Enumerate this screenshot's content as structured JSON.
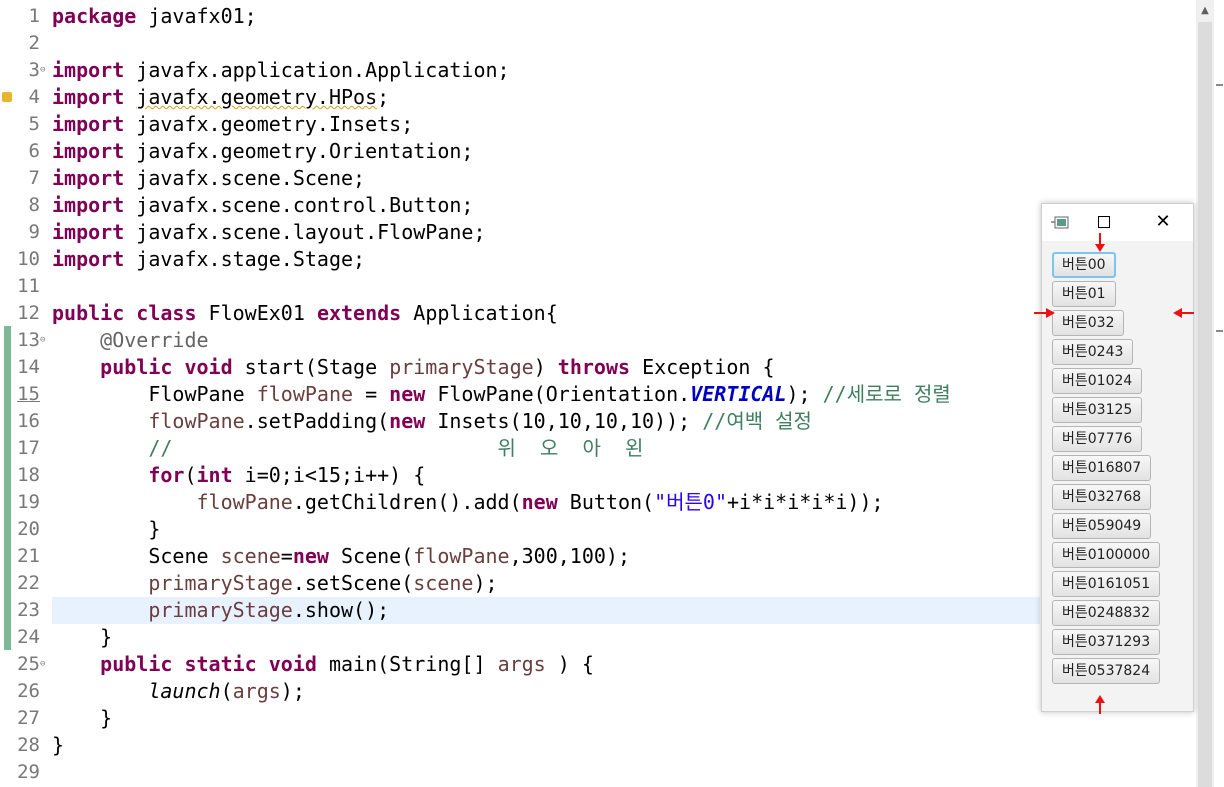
{
  "editor": {
    "lines": [
      {
        "n": "1",
        "fold": "",
        "t": [
          [
            "kw",
            "package"
          ],
          [
            "",
            "  javafx01;"
          ]
        ]
      },
      {
        "n": "2",
        "fold": "",
        "t": []
      },
      {
        "n": "3",
        "fold": "⊖",
        "t": [
          [
            "kw",
            "import"
          ],
          [
            "",
            "  javafx.application.Application;"
          ]
        ]
      },
      {
        "n": "4",
        "fold": "",
        "t": [
          [
            "kw",
            "import"
          ],
          [
            "",
            " "
          ],
          [
            "wavy",
            "javafx.geometry.HPos"
          ],
          [
            "",
            ";"
          ]
        ]
      },
      {
        "n": "5",
        "fold": "",
        "t": [
          [
            "kw",
            "import"
          ],
          [
            "",
            "  javafx.geometry.Insets;"
          ]
        ]
      },
      {
        "n": "6",
        "fold": "",
        "t": [
          [
            "kw",
            "import"
          ],
          [
            "",
            "  javafx.geometry.Orientation;"
          ]
        ]
      },
      {
        "n": "7",
        "fold": "",
        "t": [
          [
            "kw",
            "import"
          ],
          [
            "",
            "  javafx.scene.Scene;"
          ]
        ]
      },
      {
        "n": "8",
        "fold": "",
        "t": [
          [
            "kw",
            "import"
          ],
          [
            "",
            "  javafx.scene.control.Button;"
          ]
        ]
      },
      {
        "n": "9",
        "fold": "",
        "t": [
          [
            "kw",
            "import"
          ],
          [
            "",
            "  javafx.scene.layout.FlowPane;"
          ]
        ]
      },
      {
        "n": "10",
        "fold": "",
        "t": [
          [
            "kw",
            "import"
          ],
          [
            "",
            "  javafx.stage.Stage;"
          ]
        ]
      },
      {
        "n": "11",
        "fold": "",
        "t": []
      },
      {
        "n": "12",
        "fold": "",
        "t": [
          [
            "kw",
            "public"
          ],
          [
            "",
            " "
          ],
          [
            "kw",
            "class"
          ],
          [
            "",
            " FlowEx01 "
          ],
          [
            "kw",
            "extends"
          ],
          [
            "",
            " Application{"
          ]
        ]
      },
      {
        "n": "13",
        "fold": "⊖",
        "t": [
          [
            "",
            "    "
          ],
          [
            "ann",
            "@Override"
          ]
        ]
      },
      {
        "n": "14",
        "fold": "",
        "t": [
          [
            "",
            "    "
          ],
          [
            "kw",
            "public"
          ],
          [
            "",
            " "
          ],
          [
            "kw",
            "void"
          ],
          [
            "",
            " start(Stage "
          ],
          [
            "fld",
            "primaryStage"
          ],
          [
            "",
            ") "
          ],
          [
            "kw",
            "throws"
          ],
          [
            "",
            " Exception {"
          ]
        ]
      },
      {
        "n": "15",
        "fold": "",
        "t": [
          [
            "",
            "        FlowPane "
          ],
          [
            "fld",
            "flowPane"
          ],
          [
            "",
            " = "
          ],
          [
            "kw",
            "new"
          ],
          [
            "",
            " FlowPane(Orientation."
          ],
          [
            "const",
            "VERTICAL"
          ],
          [
            "",
            "); "
          ],
          [
            "cmt",
            "//세로로 정렬"
          ]
        ]
      },
      {
        "n": "16",
        "fold": "",
        "t": [
          [
            "",
            "        "
          ],
          [
            "fld",
            "flowPane"
          ],
          [
            "",
            ".setPadding("
          ],
          [
            "kw",
            "new"
          ],
          [
            "",
            " Insets(10,10,10,10)); "
          ],
          [
            "cmt",
            "//여백 설정"
          ]
        ]
      },
      {
        "n": "17",
        "fold": "",
        "t": [
          [
            "",
            "        "
          ],
          [
            "cmt",
            "//                           위  오  아  왼"
          ]
        ]
      },
      {
        "n": "18",
        "fold": "",
        "t": [
          [
            "",
            "        "
          ],
          [
            "kw",
            "for"
          ],
          [
            "",
            "("
          ],
          [
            "kw",
            "int"
          ],
          [
            "",
            " i=0;i<15;i++) {"
          ]
        ]
      },
      {
        "n": "19",
        "fold": "",
        "t": [
          [
            "",
            "            "
          ],
          [
            "fld",
            "flowPane"
          ],
          [
            "",
            ".getChildren().add("
          ],
          [
            "kw",
            "new"
          ],
          [
            "",
            " Button("
          ],
          [
            "str",
            "\"버튼0\""
          ],
          [
            "",
            "+i*i*i*i*i));"
          ]
        ]
      },
      {
        "n": "20",
        "fold": "",
        "t": [
          [
            "",
            "        }"
          ]
        ]
      },
      {
        "n": "21",
        "fold": "",
        "t": [
          [
            "",
            "        Scene "
          ],
          [
            "fld",
            "scene"
          ],
          [
            "",
            "="
          ],
          [
            "kw",
            "new"
          ],
          [
            "",
            " Scene("
          ],
          [
            "fld",
            "flowPane"
          ],
          [
            "",
            ",300,100);"
          ]
        ]
      },
      {
        "n": "22",
        "fold": "",
        "t": [
          [
            "",
            "        "
          ],
          [
            "fld",
            "primaryStage"
          ],
          [
            "",
            ".setScene("
          ],
          [
            "fld",
            "scene"
          ],
          [
            "",
            ");"
          ]
        ]
      },
      {
        "n": "23",
        "fold": "",
        "t": [
          [
            "",
            "        "
          ],
          [
            "fld",
            "primaryStage"
          ],
          [
            "",
            ".show();"
          ]
        ]
      },
      {
        "n": "24",
        "fold": "",
        "t": [
          [
            "",
            "    }"
          ]
        ]
      },
      {
        "n": "25",
        "fold": "⊖",
        "t": [
          [
            "",
            "    "
          ],
          [
            "kw",
            "public"
          ],
          [
            "",
            " "
          ],
          [
            "kw",
            "static"
          ],
          [
            "",
            " "
          ],
          [
            "kw",
            "void"
          ],
          [
            "",
            " main(String[] "
          ],
          [
            "fld",
            "args"
          ],
          [
            "",
            " ) {"
          ]
        ]
      },
      {
        "n": "26",
        "fold": "",
        "t": [
          [
            "",
            "        "
          ],
          [
            "ital",
            "launch"
          ],
          [
            "",
            "("
          ],
          [
            "fld",
            "args"
          ],
          [
            "",
            ");"
          ]
        ]
      },
      {
        "n": "27",
        "fold": "",
        "t": [
          [
            "",
            "    }"
          ]
        ]
      },
      {
        "n": "28",
        "fold": "",
        "t": [
          [
            "",
            "}"
          ]
        ]
      },
      {
        "n": "29",
        "fold": "",
        "t": []
      }
    ]
  },
  "fx_window": {
    "buttons": [
      "버튼00",
      "버튼01",
      "버튼032",
      "버튼0243",
      "버튼01024",
      "버튼03125",
      "버튼07776",
      "버튼016807",
      "버튼032768",
      "버튼059049",
      "버튼0100000",
      "버튼0161051",
      "버튼0248832",
      "버튼0371293",
      "버튼0537824"
    ],
    "close_glyph": "✕",
    "arrow_color": "#ee1111"
  },
  "colors": {
    "keyword": "#7f0055",
    "field": "#6a3e3e",
    "comment": "#3f7f5f",
    "string": "#2a00ff",
    "constant": "#0000c0",
    "current_line": "#e8f2fe"
  }
}
